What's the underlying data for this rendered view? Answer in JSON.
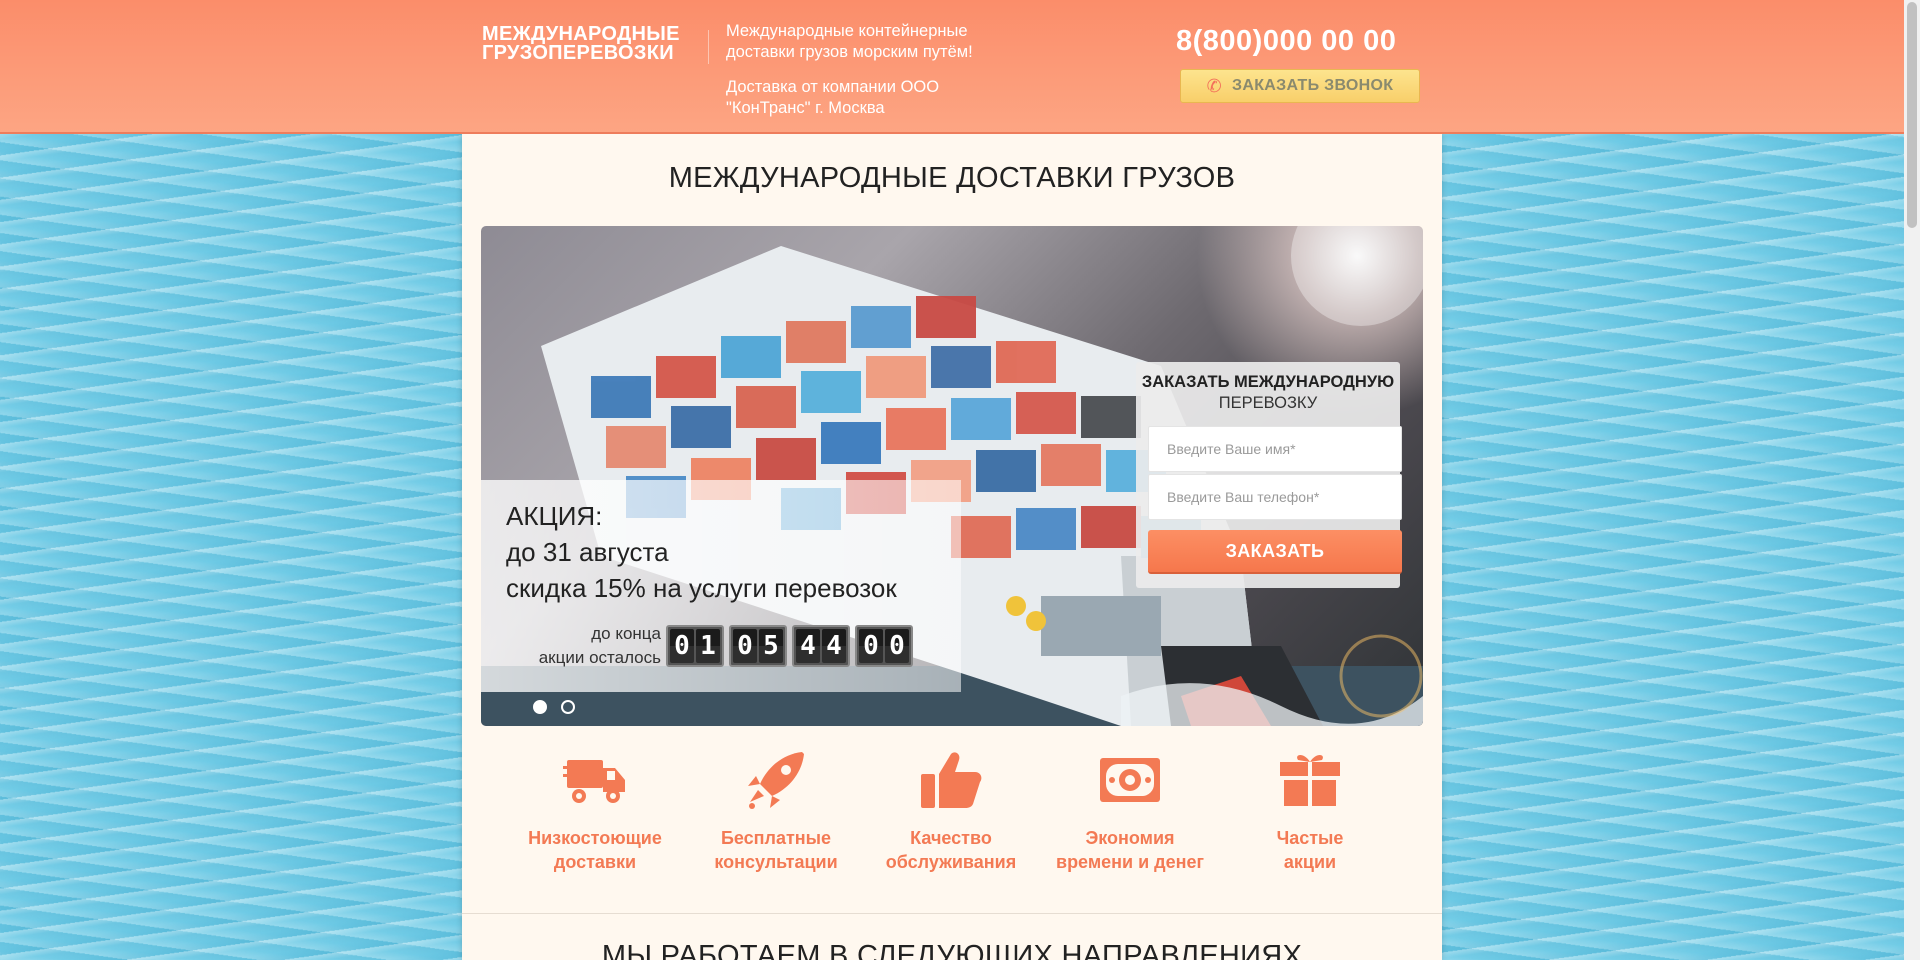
{
  "header": {
    "logo_line1": "МЕЖДУНАРОДНЫЕ",
    "logo_line2": "ГРУЗОПЕРЕВОЗКИ",
    "tagline": "Международные контейнерные доставки грузов морским путём!",
    "company": "Доставка от компании ООО \"КонТранс\" г. Москва",
    "phone": "8(800)000 00 00",
    "callback_label": "ЗАКАЗАТЬ ЗВОНОК",
    "callback_icon": "phone-icon"
  },
  "main": {
    "title": "МЕЖДУНАРОДНЫЕ ДОСТАВКИ ГРУЗОВ"
  },
  "slider": {
    "promo_title": "АКЦИЯ:",
    "promo_date": "до 31 августа",
    "promo_discount": "скидка 15% на услуги перевозок",
    "timer_label_line1": "до конца",
    "timer_label_line2": "акции осталось",
    "timer": [
      "01",
      "05",
      "44",
      "00"
    ],
    "slide_count": 2,
    "active_slide": 1
  },
  "order_form": {
    "title_bold": "ЗАКАЗАТЬ МЕЖДУНАРОДНУЮ",
    "title_rest": "ПЕРЕВОЗКУ",
    "name_placeholder": "Введите Ваше имя*",
    "name_value": "",
    "phone_placeholder": "Введите Ваш телефон*",
    "phone_value": "",
    "submit_label": "ЗАКАЗАТЬ"
  },
  "features": [
    {
      "icon": "truck-icon",
      "line1": "Низкостоющие",
      "line2": "доставки"
    },
    {
      "icon": "rocket-icon",
      "line1": "Бесплатные",
      "line2": "консультации"
    },
    {
      "icon": "thumbs-up-icon",
      "line1": "Качество",
      "line2": "обслуживания"
    },
    {
      "icon": "money-icon",
      "line1": "Экономия",
      "line2": "времени и денег"
    },
    {
      "icon": "gift-icon",
      "line1": "Частые",
      "line2": "акции"
    }
  ],
  "next_section": {
    "title": "Мы работаем в следующих направлениях"
  },
  "colors": {
    "header_orange": "#fb8d6a",
    "accent_orange": "#f37a54",
    "callback_yellow": "#fde48e",
    "content_bg": "#fff8ef",
    "water_blue": "#6fcbe6"
  }
}
